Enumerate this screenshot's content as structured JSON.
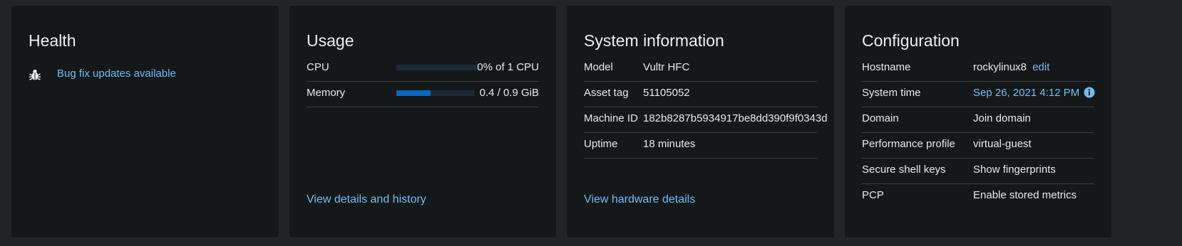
{
  "health": {
    "title": "Health",
    "items": [
      {
        "icon": "bug-icon",
        "text": "Bug fix updates available"
      }
    ]
  },
  "usage": {
    "title": "Usage",
    "rows": [
      {
        "label": "CPU",
        "value": "0% of 1 CPU",
        "fill": 0.0
      },
      {
        "label": "Memory",
        "value": "0.4 / 0.9 GiB",
        "fill": 0.44
      }
    ],
    "footer_link": "View details and history"
  },
  "system_info": {
    "title": "System information",
    "rows": [
      {
        "label": "Model",
        "value": "Vultr HFC"
      },
      {
        "label": "Asset tag",
        "value": "51105052"
      },
      {
        "label": "Machine ID",
        "value": "182b8287b5934917be8dd390f9f0343d"
      },
      {
        "label": "Uptime",
        "value": "18 minutes"
      }
    ],
    "footer_link": "View hardware details"
  },
  "configuration": {
    "title": "Configuration",
    "rows": [
      {
        "label": "Hostname",
        "value": "rockylinux8",
        "action": "edit"
      },
      {
        "label": "System time",
        "value": "Sep 26, 2021 4:12 PM",
        "icon": "info-icon"
      },
      {
        "label": "Domain",
        "value": "Join domain"
      },
      {
        "label": "Performance profile",
        "value": "virtual-guest"
      },
      {
        "label": "Secure shell keys",
        "value": "Show fingerprints"
      },
      {
        "label": "PCP",
        "value": "Enable stored metrics"
      }
    ]
  },
  "colors": {
    "background": "#222526",
    "card": "#151819",
    "link": "#73bcf7",
    "bar_track": "#1b2a38",
    "bar_fill": "#0b66c2"
  }
}
